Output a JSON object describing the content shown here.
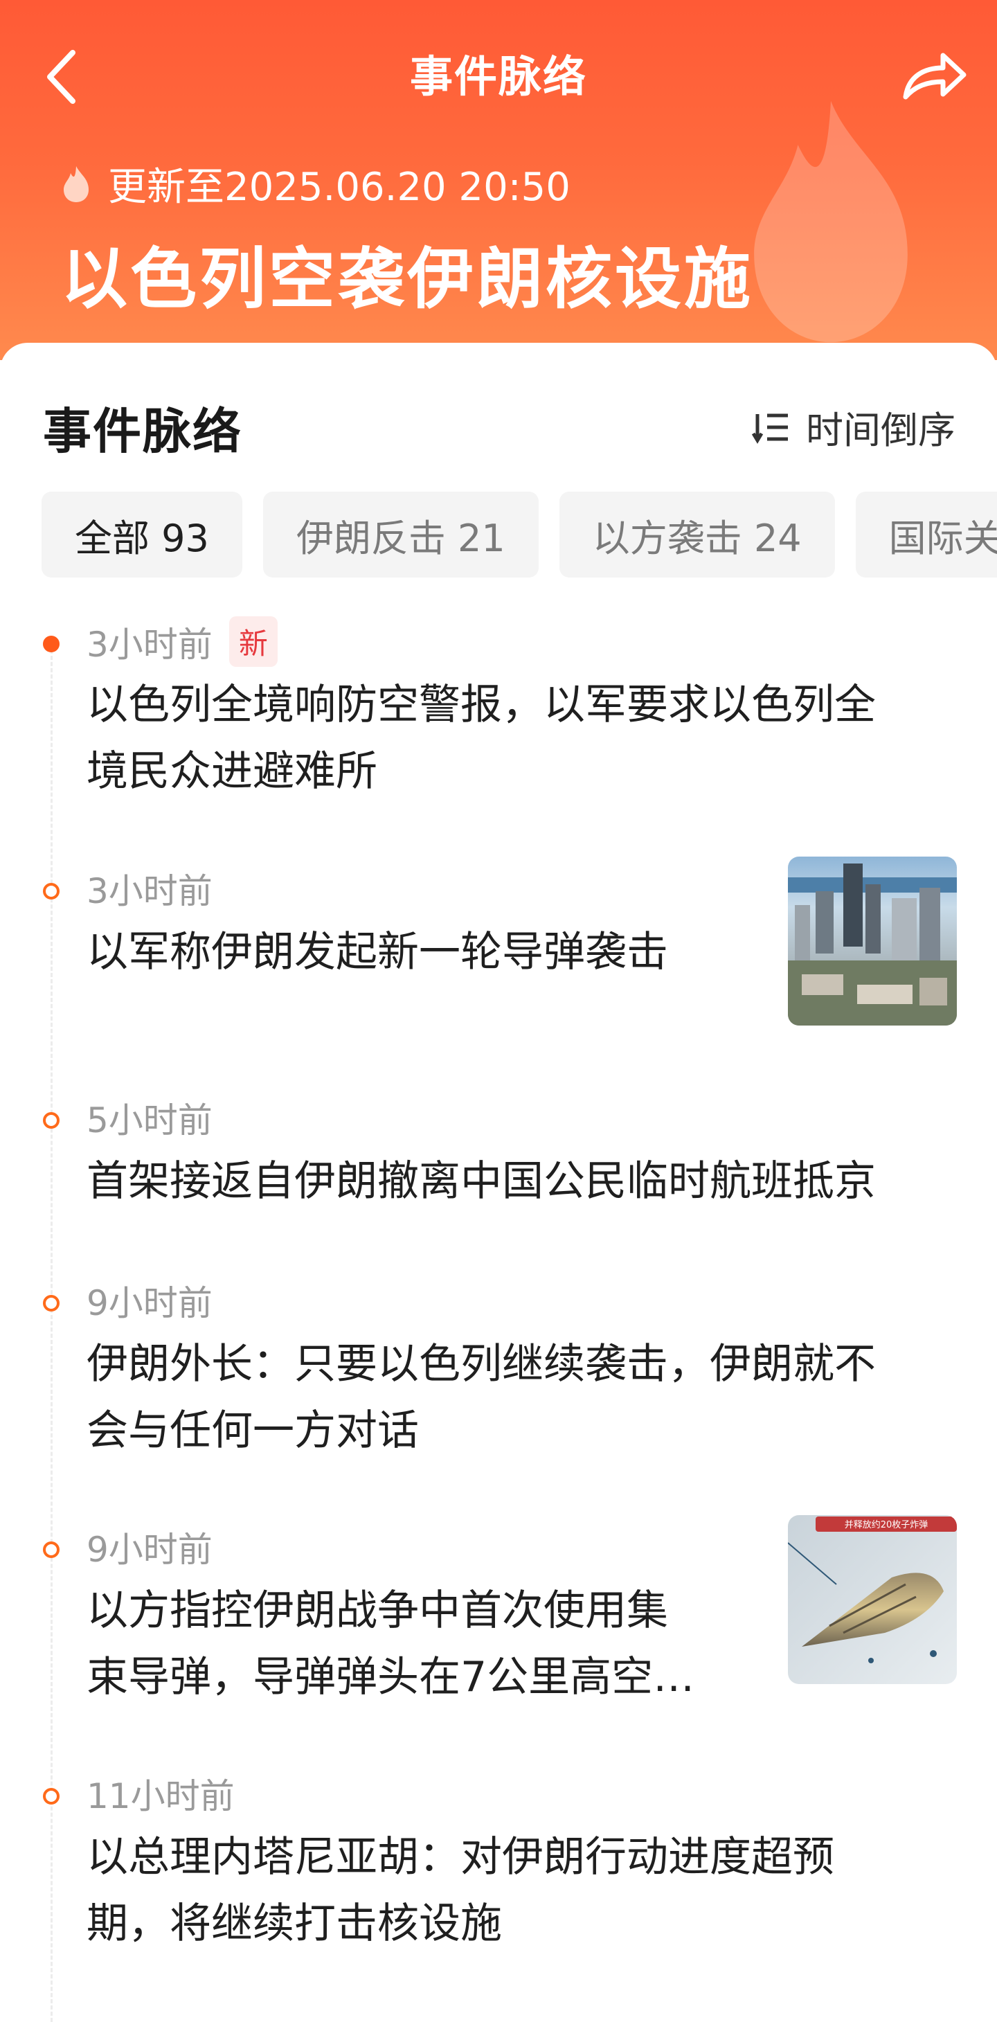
{
  "header": {
    "nav_title": "事件脉络",
    "update_text": "更新至2025.06.20 20:50",
    "event_title": "以色列空袭伊朗核设施",
    "back_icon": "back-chevron-icon",
    "share_icon": "share-arrow-icon"
  },
  "section": {
    "title": "事件脉络",
    "sort_label": "时间倒序",
    "sort_icon": "sort-order-icon"
  },
  "tabs": [
    {
      "label": "全部 93",
      "active": true
    },
    {
      "label": "伊朗反击 21",
      "active": false
    },
    {
      "label": "以方袭击 24",
      "active": false
    },
    {
      "label": "国际关",
      "active": false
    }
  ],
  "timeline": [
    {
      "time": "3小时前",
      "badge": "新",
      "lines": [
        "以色列全境响防空警报，以军要求以色列全",
        "境民众进避难所"
      ]
    },
    {
      "time": "3小时前",
      "lines": [
        "以军称伊朗发起新一轮导弹袭击"
      ],
      "thumb": "city-skyline-image"
    },
    {
      "time": "5小时前",
      "lines": [
        "首架接返自伊朗撤离中国公民临时航班抵京"
      ]
    },
    {
      "time": "9小时前",
      "lines": [
        "伊朗外长：只要以色列继续袭击，伊朗就不",
        "会与任何一方对话"
      ]
    },
    {
      "time": "9小时前",
      "lines": [
        "以方指控伊朗战争中首次使用集",
        "束导弹，导弹弹头在7公里高空…"
      ],
      "thumb": "missile-warhead-image",
      "thumb_caption": "并释放约20枚子炸弹"
    },
    {
      "time": "11小时前",
      "lines": [
        "以总理内塔尼亚胡：对伊朗行动进度超预",
        "期，将继续打击核设施"
      ]
    }
  ],
  "colors": {
    "header_top": "#ff5a36",
    "header_bottom": "#ff8a4e",
    "accent": "#ff5a1a",
    "new_badge": "#e6393e"
  }
}
